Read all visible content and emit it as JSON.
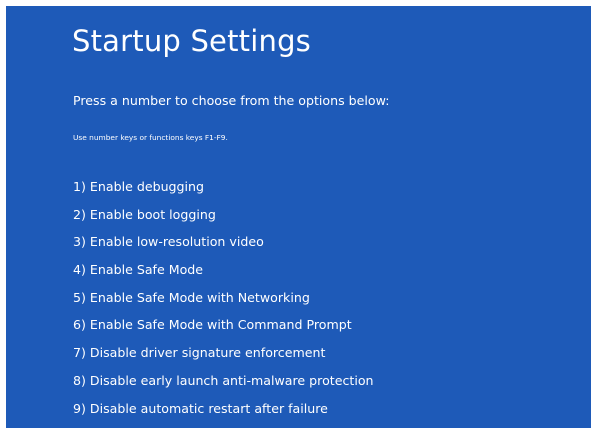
{
  "screen": {
    "background": "#1e5ab8",
    "title": "Startup Settings",
    "subtitle": "Press a number to choose from the options below:",
    "hint": "Use number keys or functions keys F1-F9.",
    "options": [
      {
        "label": "1) Enable debugging"
      },
      {
        "label": "2) Enable boot logging"
      },
      {
        "label": "3) Enable low-resolution video"
      },
      {
        "label": "4) Enable Safe Mode"
      },
      {
        "label": "5) Enable Safe Mode with Networking"
      },
      {
        "label": "6) Enable Safe Mode with Command Prompt"
      },
      {
        "label": "7) Disable driver signature enforcement"
      },
      {
        "label": "8) Disable early launch anti-malware protection"
      },
      {
        "label": "9) Disable automatic restart after failure"
      }
    ]
  }
}
